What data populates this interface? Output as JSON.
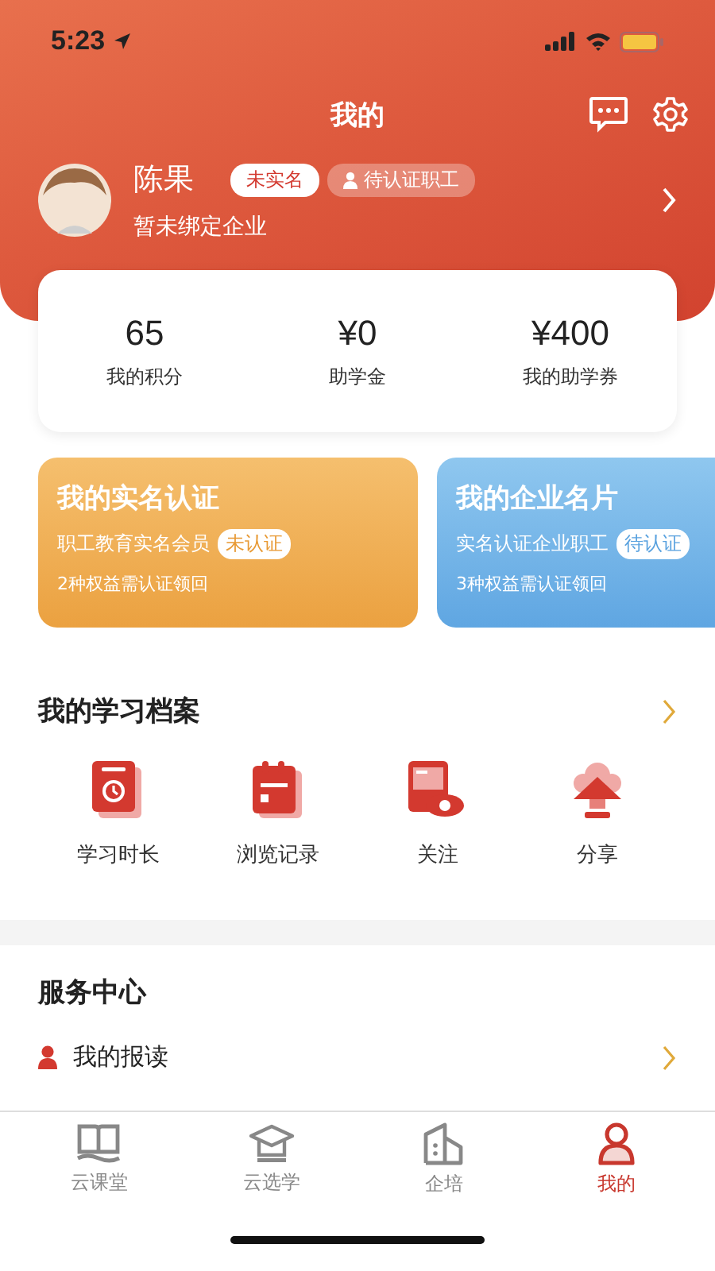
{
  "status_bar": {
    "time": "5:23"
  },
  "header": {
    "title": "我的"
  },
  "profile": {
    "name": "陈果",
    "badges": [
      {
        "label": "未实名",
        "kind": "plain"
      },
      {
        "label": "待认证职工",
        "kind": "person"
      }
    ],
    "subtitle": "暂未绑定企业"
  },
  "stats": [
    {
      "value": "65",
      "label": "我的积分"
    },
    {
      "value": "¥0",
      "label": "助学金"
    },
    {
      "value": "¥400",
      "label": "我的助学券"
    }
  ],
  "cards": [
    {
      "title": "我的实名认证",
      "line": "职工教育实名会员",
      "badge": "未认证",
      "note": "2种权益需认证领回",
      "kind": "orange"
    },
    {
      "title": "我的企业名片",
      "line": "实名认证企业职工",
      "badge": "待认证",
      "note": "3种权益需认证领回",
      "kind": "blue"
    }
  ],
  "archive": {
    "title": "我的学习档案",
    "items": [
      {
        "label": "学习时长",
        "kind": "clock"
      },
      {
        "label": "浏览记录",
        "kind": "notepad"
      },
      {
        "label": "关注",
        "kind": "eye"
      },
      {
        "label": "分享",
        "kind": "upload"
      }
    ]
  },
  "services": {
    "title": "服务中心",
    "items": [
      {
        "label": "我的报读"
      }
    ]
  },
  "tab_bar": [
    {
      "label": "云课堂",
      "kind": "book",
      "selected": false
    },
    {
      "label": "云选学",
      "kind": "cap",
      "selected": false
    },
    {
      "label": "企培",
      "kind": "building",
      "selected": false
    },
    {
      "label": "我的",
      "kind": "person",
      "selected": true
    }
  ]
}
